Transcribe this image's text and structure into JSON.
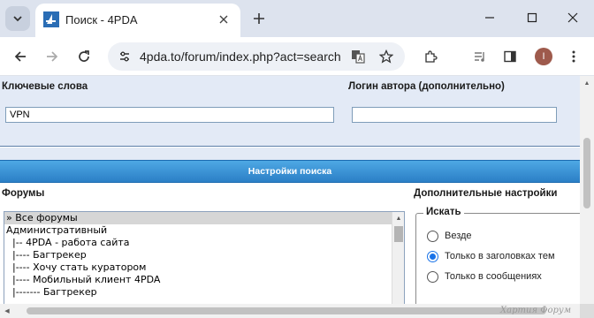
{
  "browser": {
    "tab": {
      "title": "Поиск - 4PDA",
      "favicon": "4pda-logo-icon"
    },
    "url": "4pda.to/forum/index.php?act=search",
    "profile_initial": "I",
    "icons": [
      "tab-search-icon",
      "close-icon",
      "plus-icon",
      "minimize-icon",
      "maximize-icon",
      "window-close-icon",
      "back-arrow-icon",
      "forward-arrow-icon",
      "reload-icon",
      "site-info-icon",
      "translate-icon",
      "bookmark-star-icon",
      "extensions-puzzle-icon",
      "media-control-icon",
      "side-panel-icon",
      "kebab-menu-icon"
    ]
  },
  "search_form": {
    "keywords_label": "Ключевые слова",
    "keywords_value": "VPN",
    "author_label": "Логин автора (дополнительно)",
    "author_value": "",
    "section_title": "Настройки поиска",
    "forums_label": "Форумы",
    "extra_label": "Дополнительные настройки",
    "forums": [
      "» Все форумы",
      "Административный",
      "  |-- 4PDA - работа сайта",
      "  |---- Багтрекер",
      "  |---- Хочу стать куратором",
      "  |---- Мобильный клиент 4PDA",
      "  |------- Багтрекер"
    ],
    "selected_forum_index": 0,
    "search_in": {
      "legend": "Искать",
      "options": [
        "Везде",
        "Только в заголовках тем",
        "Только в сообщениях"
      ],
      "selected_index": 1
    }
  },
  "watermark": "Хартия Форум",
  "colors": {
    "panel_bg": "#e3eaf6",
    "section_bar": "#2b7fc6",
    "accent": "#1a73e8"
  }
}
